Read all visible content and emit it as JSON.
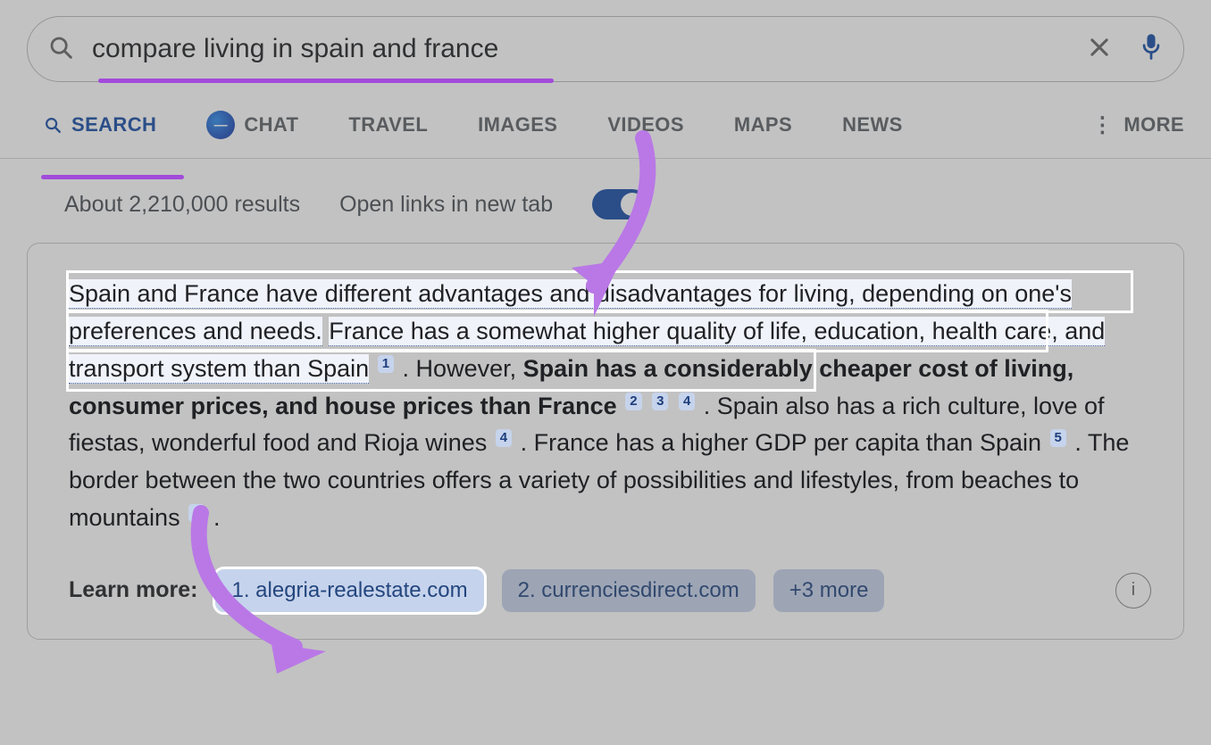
{
  "search": {
    "query": "compare living in spain and france",
    "placeholder": ""
  },
  "tabs": {
    "search": "SEARCH",
    "chat": "CHAT",
    "travel": "TRAVEL",
    "images": "IMAGES",
    "videos": "VIDEOS",
    "maps": "MAPS",
    "news": "NEWS",
    "more": "MORE"
  },
  "meta": {
    "result_count": "About 2,210,000 results",
    "open_links_label": "Open links in new tab"
  },
  "answer": {
    "seg_hl_1": "Spain and France have different advantages and disadvantages for living, depending on one's preferences and needs.",
    "seg_hl_2": "France has a somewhat higher quality of life, education, health care, and transport system than Spain",
    "cite1": "1",
    "seg_after_c1": ". However, ",
    "bold1": "Spain has a considerably cheaper cost of living, consumer prices, and house prices than France",
    "cite2": "2",
    "cite3": "3",
    "cite4a": "4",
    "seg_after_234": ". Spain also has a rich culture, love of fiestas, wonderful food and Rioja wines",
    "cite4b": "4",
    "seg_after_4b": ". France has a higher GDP per capita than Spain",
    "cite5": "5",
    "seg_after_5": ". The border between the two countries offers a variety of possibilities and lifestyles, from beaches to mountains",
    "cite4c": "4",
    "seg_end": "."
  },
  "learn_more": {
    "label": "Learn more:",
    "chip1": "1. alegria-realestate.com",
    "chip2": "2. currenciesdirect.com",
    "chip3": "+3 more"
  }
}
